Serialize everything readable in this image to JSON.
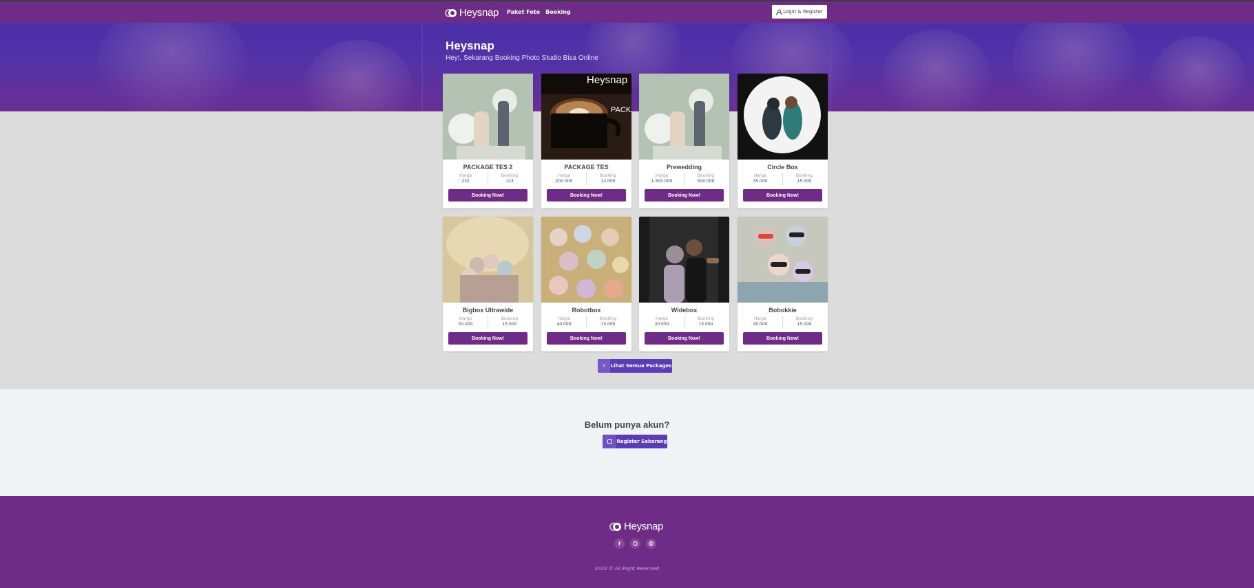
{
  "navbar": {
    "brand": "Heysnap",
    "links": [
      "Paket Foto",
      "Booking"
    ],
    "login_label": "Login & Register"
  },
  "hero": {
    "title": "Heysnap",
    "subtitle": "Hey!, Sekarang Booking Photo Studio Bisa Online"
  },
  "packages": {
    "harga_label": "Harga",
    "booking_label": "Booking",
    "button_label": "Booking Now!",
    "items": [
      {
        "name": "PACKAGE TES 2",
        "harga": "232",
        "booking": "123"
      },
      {
        "name": "PACKAGE TES",
        "harga": "200.000",
        "booking": "12.000",
        "overlay_brand": "Heysnap",
        "overlay_text": "PACKA"
      },
      {
        "name": "Prewedding",
        "harga": "1.500.000",
        "booking": "500.000"
      },
      {
        "name": "Circle Box",
        "harga": "35.000",
        "booking": "15.000"
      },
      {
        "name": "Bigbox Ultrawide",
        "harga": "50.000",
        "booking": "15.000"
      },
      {
        "name": "Robotbox",
        "harga": "40.000",
        "booking": "15.000"
      },
      {
        "name": "Widebox",
        "harga": "30.000",
        "booking": "15.000"
      },
      {
        "name": "Bobokkie",
        "harga": "30.000",
        "booking": "15.000"
      }
    ],
    "see_all_label": "Lihat Semua Packages"
  },
  "cta": {
    "title": "Belum punya akun?",
    "register_label": "Register Sekarang"
  },
  "footer": {
    "brand": "Heysnap",
    "socials": [
      "facebook-icon",
      "github-icon",
      "instagram-icon"
    ],
    "copyright": "2024 © All Right Reserved"
  },
  "colors": {
    "primary": "#6f2c86",
    "accent": "#5a3cb4",
    "page_bg": "#dcdcdc",
    "cta_bg": "#eff3f6"
  }
}
